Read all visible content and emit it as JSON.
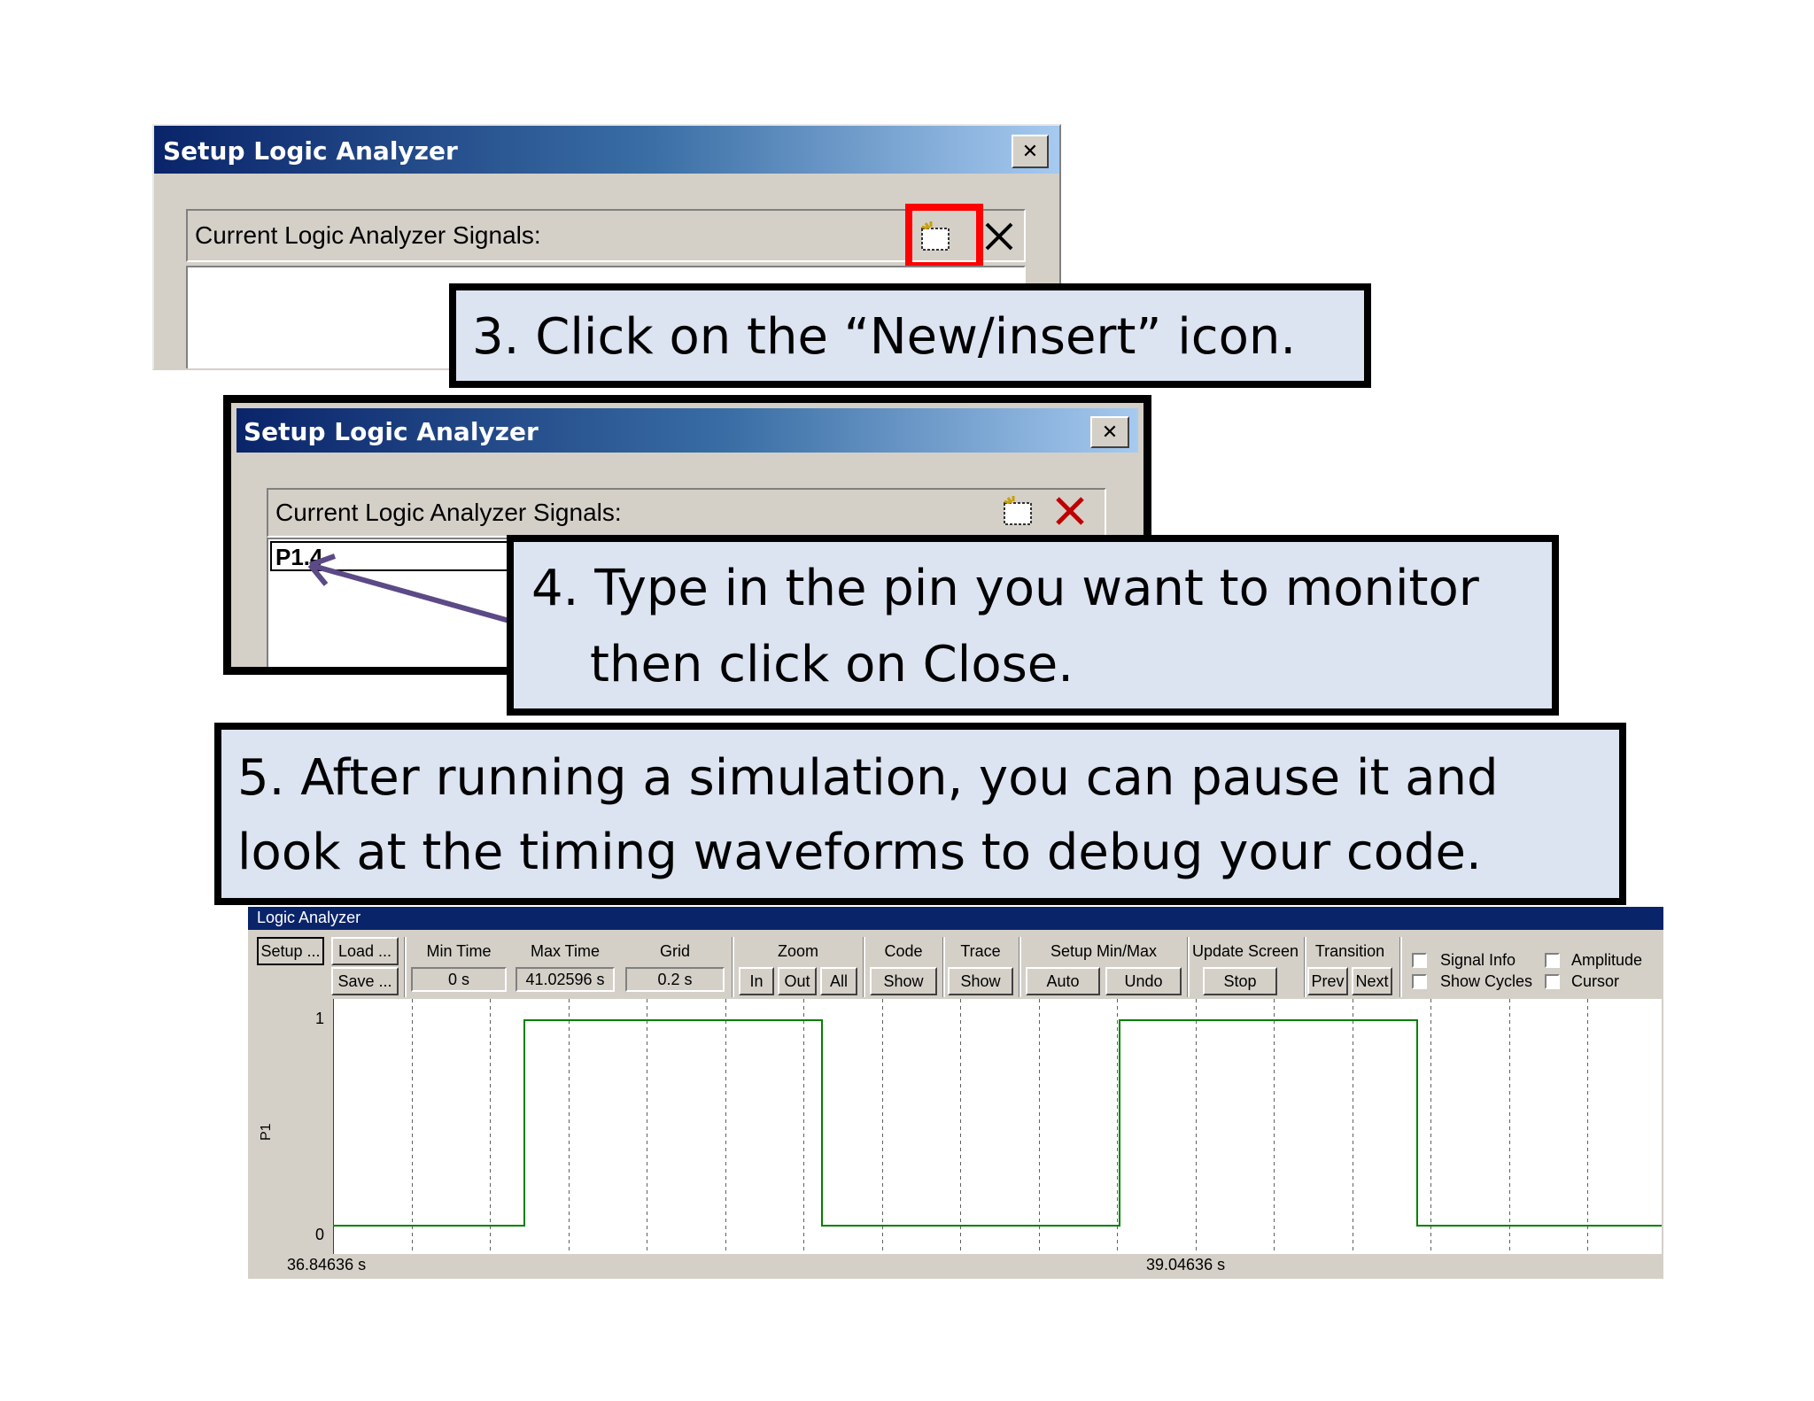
{
  "dialog1": {
    "title": "Setup Logic Analyzer",
    "close_label": "✕",
    "signals_label": "Current Logic Analyzer Signals:"
  },
  "dialog2": {
    "title": "Setup Logic Analyzer",
    "close_label": "✕",
    "signals_label": "Current Logic Analyzer Signals:",
    "signal_value": "P1.4"
  },
  "callouts": {
    "step3": "3. Click on the “New/insert” icon.",
    "step4_line1": "4. Type in the pin you want to monitor",
    "step4_line2": "then click on Close.",
    "step5_line1": "5. After running a simulation, you can pause it and",
    "step5_line2": "look at the timing waveforms to debug your code."
  },
  "logic_analyzer": {
    "title": "Logic Analyzer",
    "setup_button": "Setup ...",
    "load_button": "Load ...",
    "save_button": "Save ...",
    "min_time_label": "Min Time",
    "min_time_value": "0 s",
    "max_time_label": "Max Time",
    "max_time_value": "41.02596 s",
    "grid_label": "Grid",
    "grid_value": "0.2 s",
    "zoom_label": "Zoom",
    "zoom_in": "In",
    "zoom_out": "Out",
    "zoom_all": "All",
    "code_label": "Code",
    "code_show": "Show",
    "trace_label": "Trace",
    "trace_show": "Show",
    "setup_minmax_label": "Setup Min/Max",
    "auto_button": "Auto",
    "undo_button": "Undo",
    "update_screen_label": "Update Screen",
    "stop_button": "Stop",
    "transition_label": "Transition",
    "prev_button": "Prev",
    "next_button": "Next",
    "signal_info_label": "Signal Info",
    "show_cycles_label": "Show Cycles",
    "amplitude_label": "Amplitude",
    "cursor_label": "Cursor",
    "signal_name": "P1",
    "y_high": "1",
    "y_low": "0",
    "time_start": "36.84636 s",
    "time_mid": "39.04636 s",
    "waveform_color": "#008000",
    "transitions": [
      0,
      1,
      0,
      1,
      0
    ]
  }
}
